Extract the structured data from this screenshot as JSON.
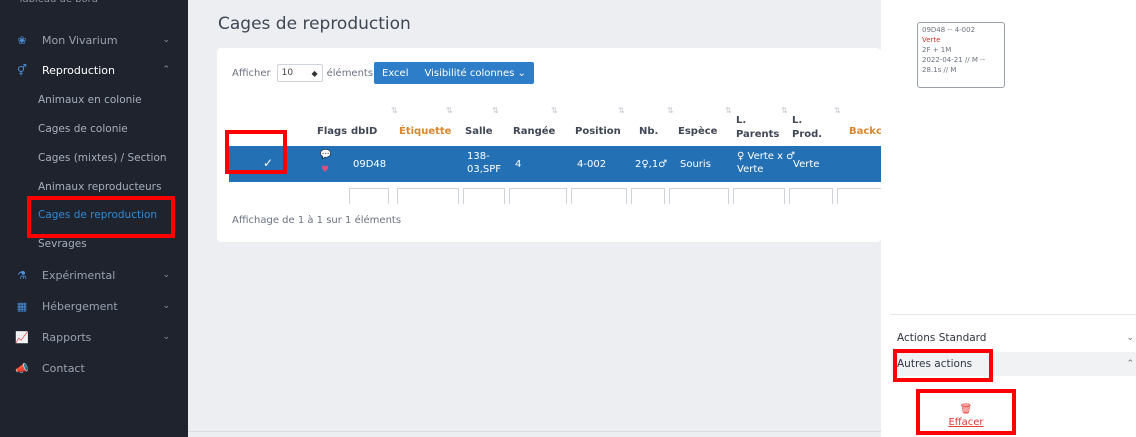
{
  "sidebar": {
    "top_cut_label": "Tableau de bord",
    "items": [
      {
        "label": "Mon Vivarium",
        "icon": "paw-icon",
        "chevron": "⌄"
      },
      {
        "label": "Reproduction",
        "icon": "gender-icon",
        "chevron": "⌃"
      },
      {
        "label": "Expérimental",
        "icon": "flask-icon",
        "chevron": "⌄"
      },
      {
        "label": "Hébergement",
        "icon": "building-icon",
        "chevron": "⌄"
      },
      {
        "label": "Rapports",
        "icon": "chart-icon",
        "chevron": "⌄"
      },
      {
        "label": "Contact",
        "icon": "megaphone-icon",
        "chevron": ""
      }
    ],
    "sub_items": [
      {
        "label": "Animaux en colonie"
      },
      {
        "label": "Cages de colonie"
      },
      {
        "label": "Cages (mixtes) / Section"
      },
      {
        "label": "Animaux reproducteurs"
      },
      {
        "label": "Cages de reproduction"
      },
      {
        "label": "Sevrages"
      }
    ]
  },
  "main": {
    "title": "Cages de reproduction",
    "show_prefix": "Afficher",
    "show_value": "10",
    "show_suffix": "éléments",
    "buttons": {
      "excel": "Excel",
      "visibility": "Visibilité colonnes ⌄"
    },
    "columns": [
      "Flags",
      "dbID",
      "Étiquette",
      "Salle",
      "Rangée",
      "Position",
      "Nb.",
      "Espèce",
      "L. Parents",
      "L. Prod.",
      "Backcr"
    ],
    "row": {
      "check": "✓",
      "flag_comment": "💬",
      "flag_heart": "♥",
      "dbid": "09D48",
      "salle": "138-\n03,SPF",
      "rangee": "4",
      "position": "4-002",
      "nb": "2♀,1♂",
      "espece": "Souris",
      "parents": "♀ Verte x ♂\nVerte",
      "prod": "Verte"
    },
    "info": "Affichage de 1 à 1 sur 1 éléments"
  },
  "right_panel": {
    "cage_card": {
      "line1": "09D48 -- 4-002",
      "line2": "Verte",
      "line3": "2F + 1M",
      "line4": "2022-04-21 // M --",
      "line5": "28.1s // M"
    },
    "actions_standard": "Actions Standard",
    "autres_actions": "Autres actions",
    "effacer": "Effacer"
  },
  "colors": {
    "sidebar_bg": "#1f232d",
    "accent_blue": "#2470b5",
    "highlight_red": "#ff0000",
    "active_link": "#2e8bd6"
  }
}
